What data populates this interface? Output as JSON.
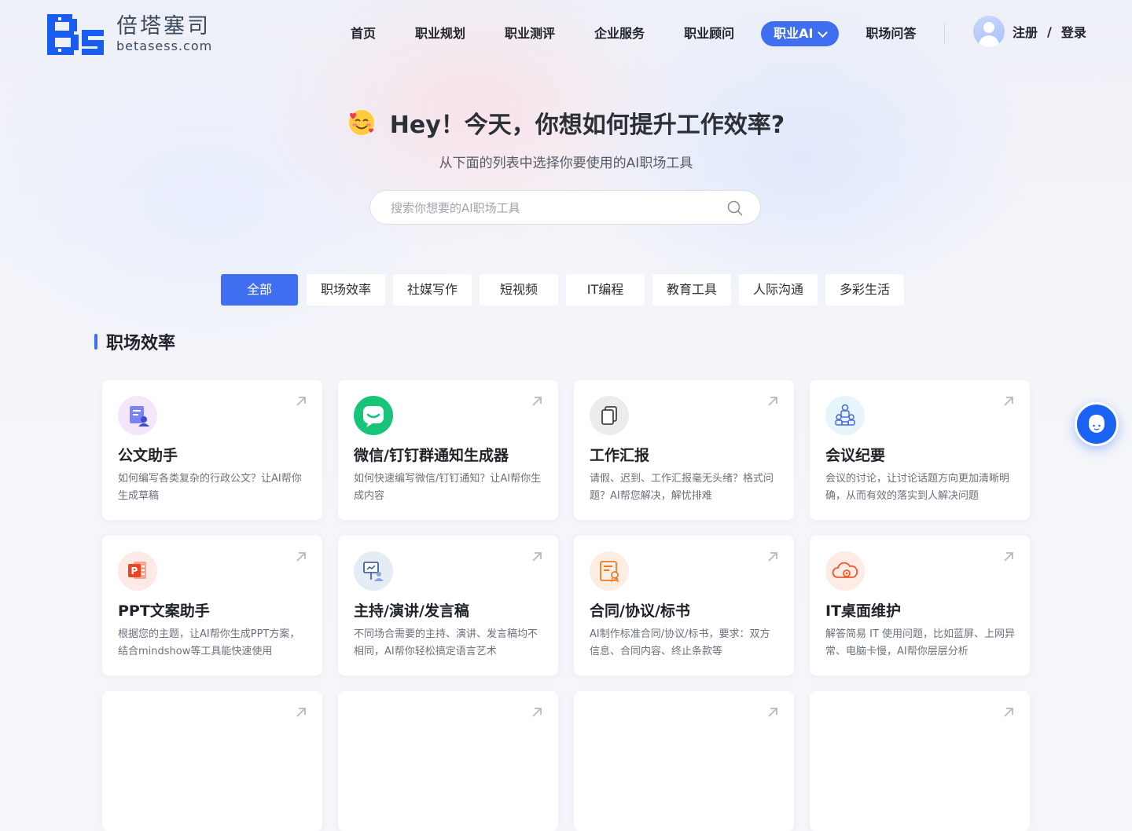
{
  "brand": {
    "name_cn": "倍塔塞司",
    "domain": "betasess.com",
    "color": "#3f6ff0"
  },
  "nav": {
    "items": [
      {
        "label": "首页"
      },
      {
        "label": "职业规划"
      },
      {
        "label": "职业测评"
      },
      {
        "label": "企业服务"
      },
      {
        "label": "职业顾问"
      },
      {
        "label": "职业AI",
        "active": true
      },
      {
        "label": "职场问答"
      }
    ],
    "register": "注册",
    "separator": "/",
    "login": "登录"
  },
  "hero": {
    "title": "Hey！今天，你想如何提升工作效率?",
    "subtitle": "从下面的列表中选择你要使用的AI职场工具",
    "search_placeholder": "搜索你想要的AI职场工具"
  },
  "tabs": [
    {
      "label": "全部",
      "active": true
    },
    {
      "label": "职场效率"
    },
    {
      "label": "社媒写作"
    },
    {
      "label": "短视频"
    },
    {
      "label": "IT编程"
    },
    {
      "label": "教育工具"
    },
    {
      "label": "人际沟通"
    },
    {
      "label": "多彩生活"
    }
  ],
  "section": {
    "title": "职场效率"
  },
  "cards": [
    {
      "title": "公文助手",
      "desc": "如何编写各类复杂的行政公文？让AI帮你生成草稿",
      "icon": "document-person-icon",
      "icon_bg": "#f4e6fb"
    },
    {
      "title": "微信/钉钉群通知生成器",
      "desc": "如何快速编写微信/钉钉通知？让AI帮你生成内容",
      "icon": "chat-bubble-icon",
      "icon_bg": "#18c37a"
    },
    {
      "title": "工作汇报",
      "desc": "请假、迟到、工作汇报毫无头绪？格式问题？AI帮您解决，解忧排难",
      "icon": "copy-document-icon",
      "icon_bg": "#ececec"
    },
    {
      "title": "会议纪要",
      "desc": "会议的讨论，让讨论话题方向更加清晰明确，从而有效的落实到人解决问题",
      "icon": "meeting-icon",
      "icon_bg": "#e6f5fb"
    },
    {
      "title": "PPT文案助手",
      "desc": "根据您的主题，让AI帮你生成PPT方案，结合mindshow等工具能快速使用",
      "icon": "ppt-icon",
      "icon_bg": "#fde9e5"
    },
    {
      "title": "主持/演讲/发言稿",
      "desc": "不同场合需要的主持、演讲、发言稿均不相同，AI帮你轻松搞定语言艺术",
      "icon": "presentation-icon",
      "icon_bg": "#e6ecf4"
    },
    {
      "title": "合同/协议/标书",
      "desc": "AI制作标准合同/协议/标书，要求：双方信息、合同内容、终止条款等",
      "icon": "contract-icon",
      "icon_bg": "#fdeee3"
    },
    {
      "title": "IT桌面维护",
      "desc": "解答简易 IT 使用问题，比如蓝屏、上网异常、电脑卡慢，AI帮你层层分析",
      "icon": "cloud-gear-icon",
      "icon_bg": "#fdebe4"
    }
  ]
}
